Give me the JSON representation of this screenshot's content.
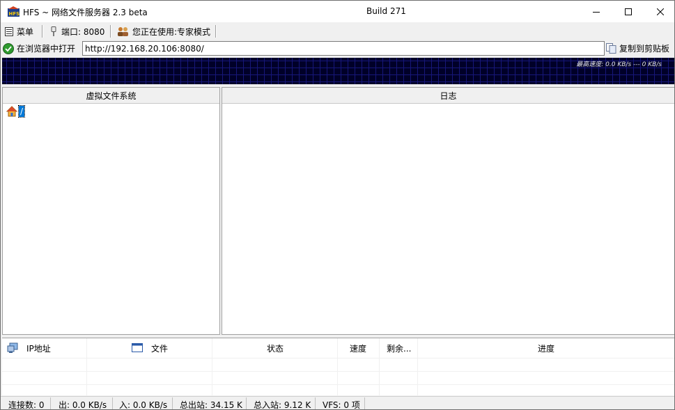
{
  "window": {
    "title": "HFS ~ 网络文件服务器 2.3 beta",
    "build": "Build 271"
  },
  "toolbar": {
    "menu": "菜单",
    "port": "端口: 8080",
    "mode": "您正在使用:专家模式"
  },
  "urlbar": {
    "open_in_browser": "在浏览器中打开",
    "url": "http://192.168.20.106:8080/",
    "copy": "复制到剪贴板"
  },
  "graph": {
    "speed_label": "最高速度: 0.0 KB/s --- 0 KB/s"
  },
  "vfs": {
    "header": "虚拟文件系统",
    "root": "/"
  },
  "log": {
    "header": "日志"
  },
  "connections": {
    "columns": [
      "IP地址",
      "文件",
      "状态",
      "速度",
      "剩余...",
      "进度"
    ]
  },
  "status": {
    "connections": "连接数: 0",
    "out": "出: 0.0 KB/s",
    "in": "入: 0.0 KB/s",
    "total_out": "总出站: 34.15 K",
    "total_in": "总入站: 9.12 K",
    "vfs": "VFS: 0 项"
  },
  "icons": {
    "app": "hfs-logo-icon",
    "menu": "menu-icon",
    "port": "plug-icon",
    "mode": "users-icon",
    "browser": "globe-icon",
    "copy": "clipboard-icon",
    "home": "home-icon",
    "ip": "network-icon",
    "file": "file-window-icon"
  },
  "colors": {
    "graph_bg": "#000028",
    "graph_grid": "#17177a",
    "selection": "#0078d7"
  }
}
